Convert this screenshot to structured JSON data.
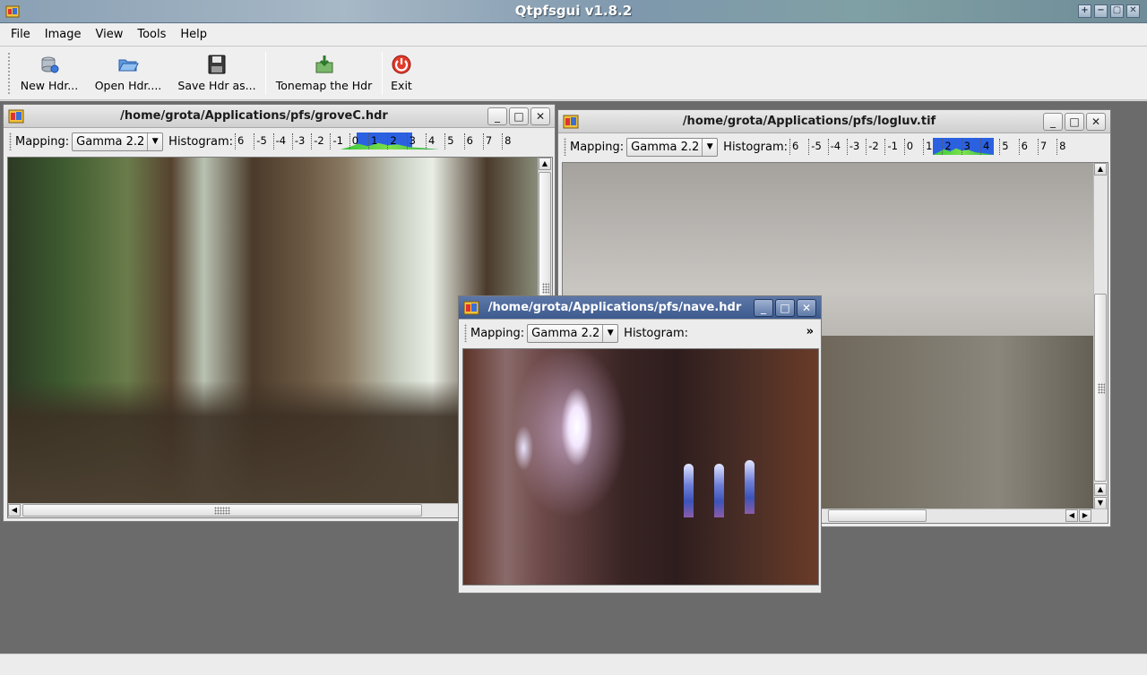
{
  "app": {
    "title": "Qtpfsgui v1.8.2",
    "title_buttons": [
      "+",
      "−",
      "▢",
      "✕"
    ]
  },
  "menu": [
    "File",
    "Image",
    "View",
    "Tools",
    "Help"
  ],
  "toolbar": {
    "new_hdr": "New Hdr...",
    "open_hdr": "Open Hdr....",
    "save_hdr": "Save Hdr as...",
    "tonemap": "Tonemap the Hdr",
    "exit": "Exit"
  },
  "windows": {
    "grove": {
      "title": "/home/grota/Applications/pfs/groveC.hdr",
      "mapping_label": "Mapping:",
      "mapping_value": "Gamma 2.2",
      "histogram_label": "Histogram:",
      "ticks": [
        "6",
        "-5",
        "-4",
        "-3",
        "-2",
        "-1",
        "0",
        "1",
        "2",
        "3",
        "4",
        "5",
        "6",
        "7",
        "8"
      ]
    },
    "logluv": {
      "title": "/home/grota/Applications/pfs/logluv.tif",
      "mapping_label": "Mapping:",
      "mapping_value": "Gamma 2.2",
      "histogram_label": "Histogram:",
      "ticks": [
        "6",
        "-5",
        "-4",
        "-3",
        "-2",
        "-1",
        "0",
        "1",
        "2",
        "3",
        "4",
        "5",
        "6",
        "7",
        "8"
      ]
    },
    "nave": {
      "title": "/home/grota/Applications/pfs/nave.hdr",
      "mapping_label": "Mapping:",
      "mapping_value": "Gamma 2.2",
      "histogram_label": "Histogram:",
      "more": "»"
    }
  },
  "colors": {
    "histogram_selection": "#1a55e0",
    "histogram_curve": "#37c63b",
    "active_titlebar": "#3d5a8e",
    "mdi_background": "#6b6b6b"
  }
}
